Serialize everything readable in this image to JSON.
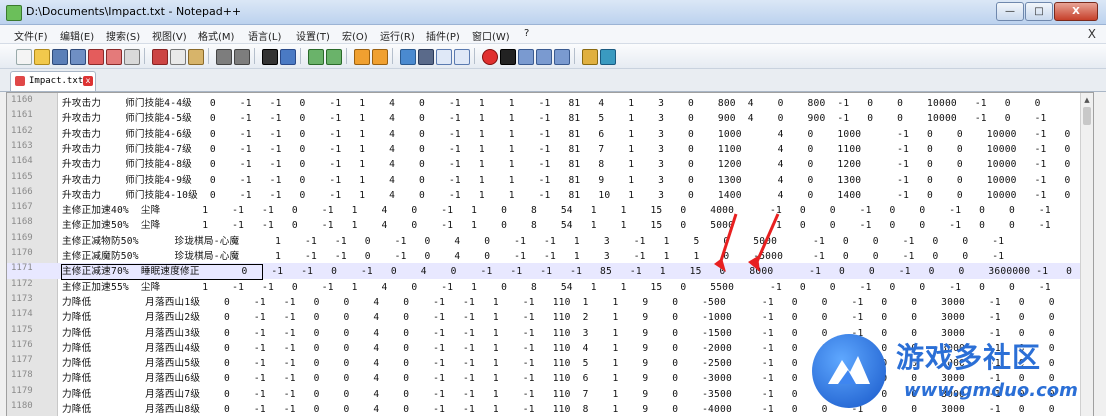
{
  "window": {
    "title": "D:\\Documents\\Impact.txt - Notepad++",
    "minimize": "—",
    "maximize": "□",
    "close": "X"
  },
  "menubar": {
    "items": [
      "文件(F)",
      "编辑(E)",
      "搜索(S)",
      "视图(V)",
      "格式(M)",
      "语言(L)",
      "设置(T)",
      "宏(O)",
      "运行(R)",
      "插件(P)",
      "窗口(W)",
      "?"
    ],
    "close": "X"
  },
  "tab": {
    "label": "Impact.txt"
  },
  "editor": {
    "lines": [
      {
        "n": "1160",
        "text": "升攻击力    师门技能4-4级   0    -1   -1   0    -1   1    4    0    -1   1    1    -1   81   4    1    3    0    800  4    0    800  -1   0    0    10000   -1   0    0"
      },
      {
        "n": "1161",
        "text": "升攻击力    师门技能4-5级   0    -1   -1   0    -1   1    4    0    -1   1    1    -1   81   5    1    3    0    900  4    0    900  -1   0    0    10000   -1   0    -1"
      },
      {
        "n": "1162",
        "text": "升攻击力    师门技能4-6级   0    -1   -1   0    -1   1    4    0    -1   1    1    -1   81   6    1    3    0    1000      4    0    1000      -1   0    0    10000   -1   0"
      },
      {
        "n": "1163",
        "text": "升攻击力    师门技能4-7级   0    -1   -1   0    -1   1    4    0    -1   1    1    -1   81   7    1    3    0    1100      4    0    1100      -1   0    0    10000   -1   0"
      },
      {
        "n": "1164",
        "text": "升攻击力    师门技能4-8级   0    -1   -1   0    -1   1    4    0    -1   1    1    -1   81   8    1    3    0    1200      4    0    1200      -1   0    0    10000   -1   0"
      },
      {
        "n": "1165",
        "text": "升攻击力    师门技能4-9级   0    -1   -1   0    -1   1    4    0    -1   1    1    -1   81   9    1    3    0    1300      4    0    1300      -1   0    0    10000   -1   0"
      },
      {
        "n": "1166",
        "text": "升攻击力    师门技能4-10级  0    -1   -1   0    -1   1    4    0    -1   1    1    -1   81   10   1    3    0    1400      4    0    1400      -1   0    0    10000   -1   0"
      },
      {
        "n": "1167",
        "text": "主修正加速40%  尘降       1    -1   -1   0    -1   1    4    0    -1   1    0    8    54   1    1    15   0    4000      -1   0    0    -1   0    0    -1   0    0    -1"
      },
      {
        "n": "1168",
        "text": "主修正加速50%  尘降       1    -1   -1   0    -1   1    4    0    -1   1    0    8    54   1    1    15   0    5000      -1   0    0    -1   0    0    -1   0    0    -1"
      },
      {
        "n": "1169",
        "text": "主修正减物防50%      珍珑棋局-心魔      1    -1   -1   0    -1   0    4    0    -1   -1   1    3    -1   1    5    0    5000      -1   0    0    -1   0    0    -1"
      },
      {
        "n": "1170",
        "text": "主修正减魔防50%      珍珑棋局-心魔      1    -1   -1   0    -1   0    4    0    -1   -1   1    3    -1   1    1    0    -5000     -1   0    0    -1   0    0    -1"
      },
      {
        "n": "1171",
        "text": "主修正减速70%  睡眠速度修正       0    -1   -1   0    -1   0    4    0    -1   -1   -1   -1   85   -1   1    15   0    8000      -1   0    0    -1   0    0    3600000 -1   0"
      },
      {
        "n": "1172",
        "text": "主修正加速55%  尘降       1    -1   -1   0    -1   1    4    0    -1   1    0    8    54   1    1    15   0    5500      -1   0    0    -1   0    0    -1   0    0    -1"
      },
      {
        "n": "1173",
        "text": "力降低         月落西山1级    0    -1   -1   0    0    4    0    -1   -1   1    -1   110  1    1    9    0    -500      -1   0    0    -1   0    0    3000    -1   0    0"
      },
      {
        "n": "1174",
        "text": "力降低         月落西山2级    0    -1   -1   0    0    4    0    -1   -1   1    -1   110  2    1    9    0    -1000     -1   0    0    -1   0    0    3000    -1   0    0"
      },
      {
        "n": "1175",
        "text": "力降低         月落西山3级    0    -1   -1   0    0    4    0    -1   -1   1    -1   110  3    1    9    0    -1500     -1   0    0    -1   0    0    3000    -1   0    0"
      },
      {
        "n": "1176",
        "text": "力降低         月落西山4级    0    -1   -1   0    0    4    0    -1   -1   1    -1   110  4    1    9    0    -2000     -1   0    0    -1   0    0    3000    -1   0    0"
      },
      {
        "n": "1177",
        "text": "力降低         月落西山5级    0    -1   -1   0    0    4    0    -1   -1   1    -1   110  5    1    9    0    -2500     -1   0    0    -1   0    0    3000    -1   0    0"
      },
      {
        "n": "1178",
        "text": "力降低         月落西山6级    0    -1   -1   0    0    4    0    -1   -1   1    -1   110  6    1    9    0    -3000     -1   0    0    -1   0    0    3000    -1   0    0"
      },
      {
        "n": "1179",
        "text": "力降低         月落西山7级    0    -1   -1   0    0    4    0    -1   -1   1    -1   110  7    1    9    0    -3500     -1   0    0    -1   0    0    3000    -1   0    0"
      },
      {
        "n": "1180",
        "text": "力降低         月落西山8级    0    -1   -1   0    0    4    0    -1   -1   1    -1   110  8    1    9    0    -4000     -1   0    0    -1   0    0    3000    -1   0    0"
      }
    ],
    "highlighted_line": "1171",
    "scroll_up": "▲"
  },
  "watermark": {
    "name": "游戏多社区",
    "url": "www.gmduo.com"
  },
  "colors": {
    "annotation_arrow": "#e82020",
    "watermark_blue": "#2b6fd6",
    "highlight_row": "#e8e8ff"
  }
}
